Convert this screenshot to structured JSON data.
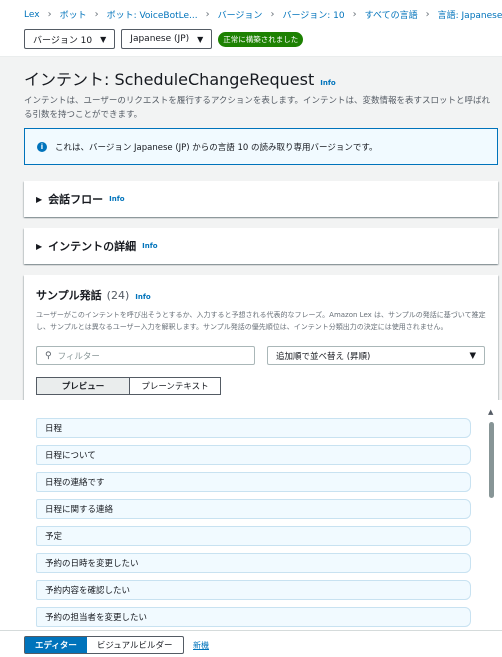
{
  "breadcrumbs": [
    "Lex",
    "ボット",
    "ボット: VoiceBotLe...",
    "バージョン",
    "バージョン: 10",
    "すべての言語",
    "言語: Japanese (JP)"
  ],
  "version_select": "バージョン 10",
  "language_select": "Japanese (JP)",
  "build_badge": "正常に構築されました",
  "intent": {
    "title": "インテント: ScheduleChangeRequest",
    "info": "Info",
    "description": "インテントは、ユーザーのリクエストを履行するアクションを表します。インテントは、変数情報を表すスロットと呼ばれる引数を持つことができます。"
  },
  "alert_text": "これは、バージョン Japanese (JP) からの言語 10 の読み取り専用バージョンです。",
  "sections": {
    "conversation_flow": "会話フロー",
    "intent_details": "インテントの詳細",
    "info": "Info"
  },
  "samples": {
    "title": "サンプル発話",
    "count": "(24)",
    "info": "Info",
    "description": "ユーザーがこのインテントを呼び出そうとするか、入力すると予想される代表的なフレーズ。Amazon Lex は、サンプルの発話に基づいて推定し、サンプルとは異なるユーザー入力を解釈します。サンプル発話の優先順位は、インテント分類出力の決定には使用されません。",
    "filter_placeholder": "フィルター",
    "sort_label": "追加順で並べ替え (昇順)",
    "tab_preview": "プレビュー",
    "tab_plaintext": "プレーンテキスト",
    "items": [
      "日程",
      "日程について",
      "日程の連絡です",
      "日程に関する連絡",
      "予定",
      "予約の日時を変更したい",
      "予約内容を確認したい",
      "予約の担当者を変更したい"
    ]
  },
  "bottom": {
    "editor": "エディター",
    "visual_builder": "ビジュアルビルダー",
    "new_label": "新機"
  }
}
